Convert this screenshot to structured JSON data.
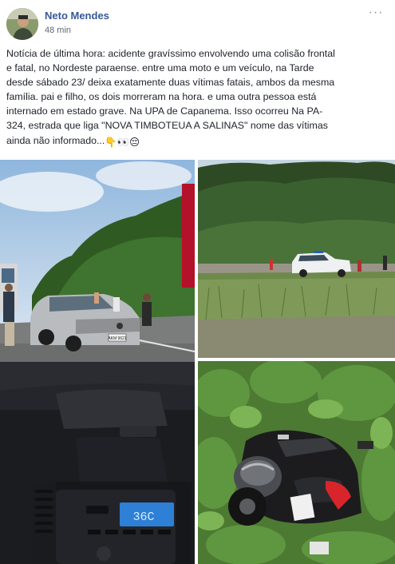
{
  "post": {
    "author": "Neto Mendes",
    "time": "48 min",
    "text_lines": [
      "Notícia de última hora: acidente gravíssimo envolvendo uma colisão frontal",
      "e fatal, no Nordeste paraense. entre uma moto e um veículo, na Tarde",
      "desde sábado 23/ deixa exatamente duas vítimas fatais, ambos da mesma",
      "família. pai e filho, os dois morreram na hora. e uma outra pessoa está",
      "internado em estado grave. Na UPA de Capanema. Isso ocorreu Na PA-",
      "324, estrada que liga \"NOVA TIMBOTEUA A SALINAS\" nome das vítimas",
      "ainda não informado..."
    ],
    "emojis": "👇👀😔"
  },
  "photos": {
    "crash_plate": "AKM 9621",
    "dashboard_display": "36C"
  },
  "colors": {
    "author_link": "#365899",
    "meta_text": "#616770"
  },
  "icons": {
    "more": "ellipsis-icon"
  }
}
